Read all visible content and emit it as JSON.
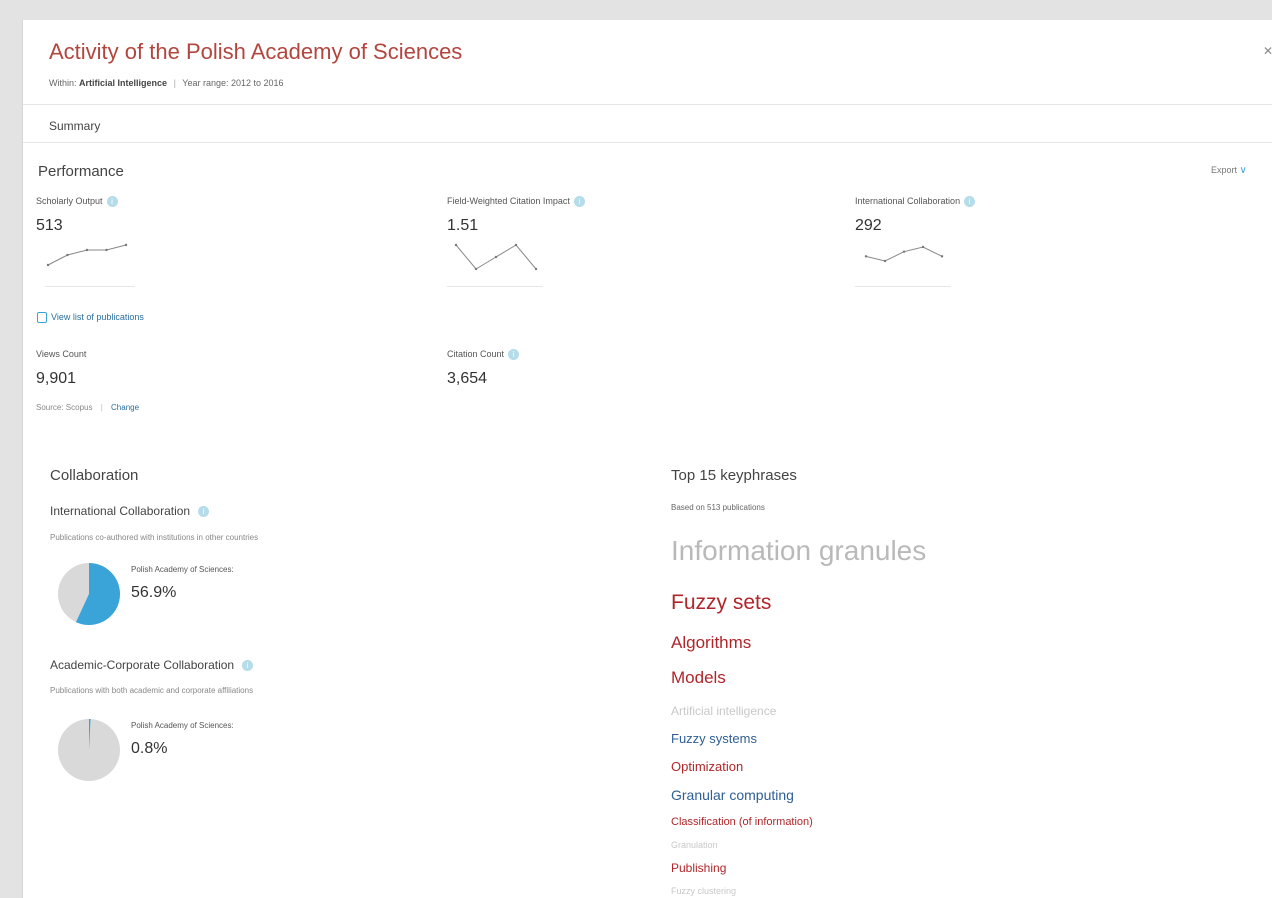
{
  "header": {
    "title": "Activity of the Polish Academy of Sciences",
    "within_label": "Within:",
    "within_value": "Artificial Intelligence",
    "year_range": "Year range: 2012 to 2016",
    "close_icon": "close-icon"
  },
  "tabs": {
    "summary": "Summary"
  },
  "performance": {
    "heading": "Performance",
    "export_label": "Export",
    "metrics": [
      {
        "label": "Scholarly Output",
        "value": "513",
        "trend": [
          3,
          5,
          6,
          6,
          7
        ]
      },
      {
        "label": "Field-Weighted Citation Impact",
        "value": "1.51",
        "trend": [
          7,
          3,
          5,
          7,
          3
        ]
      },
      {
        "label": "International Collaboration",
        "value": "292",
        "trend": [
          4,
          3,
          5,
          6,
          4
        ]
      }
    ],
    "view_list_label": "View list of publications",
    "views_count_label": "Views Count",
    "views_count_value": "9,901",
    "citation_count_label": "Citation Count",
    "citation_count_value": "3,654",
    "source_label": "Source: Scopus",
    "change_label": "Change"
  },
  "collaboration": {
    "heading": "Collaboration",
    "international": {
      "title": "International Collaboration",
      "description": "Publications co-authored with institutions in other countries",
      "entity": "Polish Academy of Sciences:",
      "value": "56.9%",
      "fraction": 0.569
    },
    "academic_corporate": {
      "title": "Academic-Corporate Collaboration",
      "description": "Publications with both academic and corporate affiliations",
      "entity": "Polish Academy of Sciences:",
      "value": "0.8%",
      "fraction": 0.008
    }
  },
  "keyphrases": {
    "heading": "Top 15 keyphrases",
    "based_on": "Based on 513 publications",
    "items": [
      {
        "text": "Information granules",
        "color": "#b9b9b9"
      },
      {
        "text": "Fuzzy sets",
        "color": "#b0262a"
      },
      {
        "text": "Algorithms",
        "color": "#b0262a"
      },
      {
        "text": "Models",
        "color": "#b0262a"
      },
      {
        "text": "Artificial intelligence",
        "color": "#c8c8c8"
      },
      {
        "text": "Fuzzy systems",
        "color": "#2f5f95"
      },
      {
        "text": "Optimization",
        "color": "#b0262a"
      },
      {
        "text": "Granular computing",
        "color": "#2f5f95"
      },
      {
        "text": "Classification (of information)",
        "color": "#b0262a"
      },
      {
        "text": "Granulation",
        "color": "#c8c8c8"
      },
      {
        "text": "Publishing",
        "color": "#b0262a"
      },
      {
        "text": "Fuzzy clustering",
        "color": "#c8c8c8"
      }
    ]
  },
  "colors": {
    "accent_blue": "#3aa4d8",
    "title_red": "#b2463f",
    "pie_grey": "#d9d9d9"
  }
}
